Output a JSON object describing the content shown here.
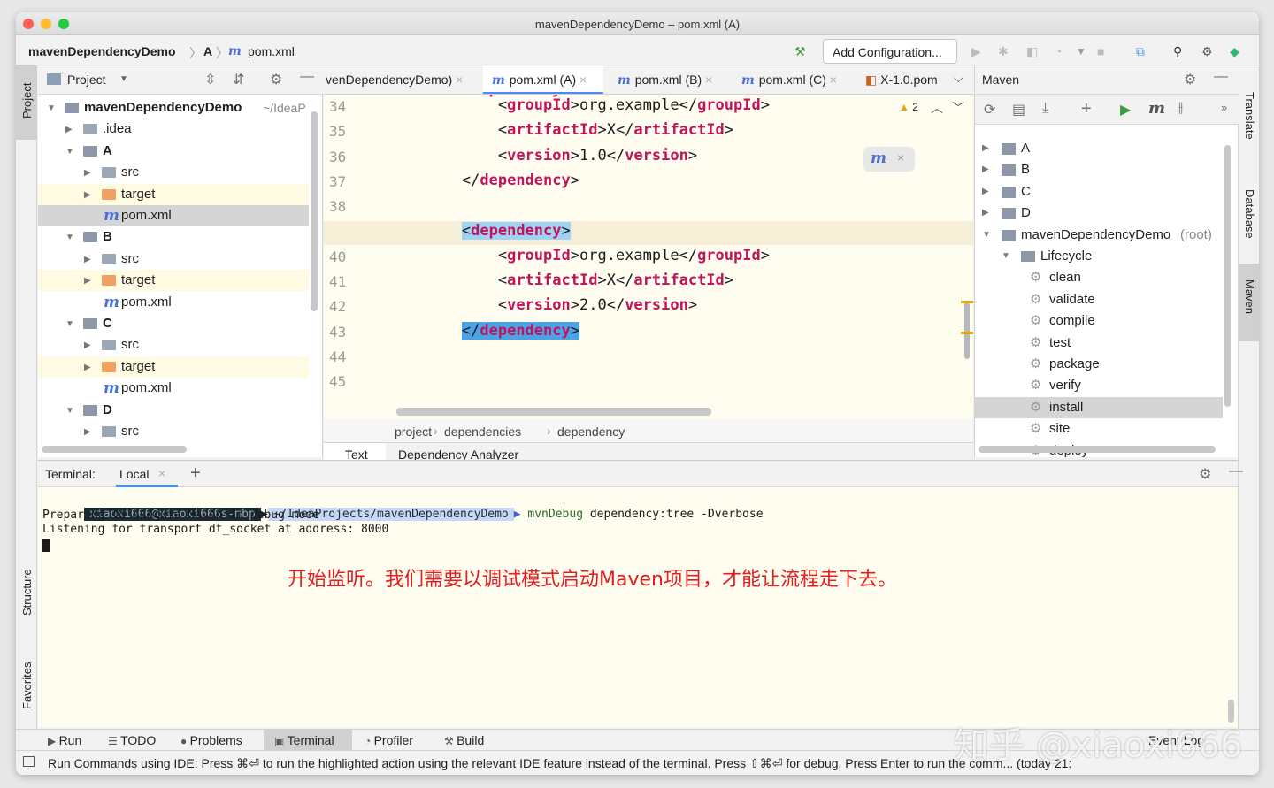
{
  "window": {
    "title": "mavenDependencyDemo – pom.xml (A)"
  },
  "nav": {
    "project": "mavenDependencyDemo",
    "module": "A",
    "file": "pom.xml",
    "add_configuration": "Add Configuration..."
  },
  "project_panel": {
    "title": "Project",
    "tree": [
      {
        "label": "mavenDependencyDemo",
        "suffix": "~/IdeaP",
        "level": 0,
        "expanded": true,
        "type": "module",
        "bold": true
      },
      {
        "label": ".idea",
        "level": 1,
        "expanded": false,
        "type": "folder"
      },
      {
        "label": "A",
        "level": 1,
        "expanded": true,
        "type": "module",
        "bold": true
      },
      {
        "label": "src",
        "level": 2,
        "expanded": false,
        "type": "folder"
      },
      {
        "label": "target",
        "level": 2,
        "expanded": false,
        "type": "target"
      },
      {
        "label": "pom.xml",
        "level": 2,
        "type": "pom",
        "selected": true
      },
      {
        "label": "B",
        "level": 1,
        "expanded": true,
        "type": "module",
        "bold": true
      },
      {
        "label": "src",
        "level": 2,
        "expanded": false,
        "type": "folder"
      },
      {
        "label": "target",
        "level": 2,
        "expanded": false,
        "type": "target"
      },
      {
        "label": "pom.xml",
        "level": 2,
        "type": "pom"
      },
      {
        "label": "C",
        "level": 1,
        "expanded": true,
        "type": "module",
        "bold": true
      },
      {
        "label": "src",
        "level": 2,
        "expanded": false,
        "type": "folder"
      },
      {
        "label": "target",
        "level": 2,
        "expanded": false,
        "type": "target"
      },
      {
        "label": "pom.xml",
        "level": 2,
        "type": "pom"
      },
      {
        "label": "D",
        "level": 1,
        "expanded": true,
        "type": "module",
        "bold": true
      },
      {
        "label": "src",
        "level": 2,
        "expanded": false,
        "type": "folder"
      }
    ]
  },
  "editor": {
    "tabs": [
      {
        "label": "venDependencyDemo)"
      },
      {
        "label": "pom.xml (A)",
        "active": true
      },
      {
        "label": "pom.xml (B)"
      },
      {
        "label": "pom.xml (C)"
      },
      {
        "label": "X-1.0.pom"
      }
    ],
    "warning_count": "2",
    "lines": [
      {
        "n": "34",
        "indent": "            ",
        "open": "groupId",
        "text": "org.example",
        "close": "groupId"
      },
      {
        "n": "35",
        "indent": "            ",
        "open": "artifactId",
        "text": "X",
        "close": "artifactId"
      },
      {
        "n": "36",
        "indent": "            ",
        "open": "version",
        "text": "1.0",
        "close": "version"
      },
      {
        "n": "37",
        "indent": "        ",
        "close_only": "dependency"
      },
      {
        "n": "38"
      },
      {
        "n": "39",
        "indent": "        ",
        "open_only": "dependency",
        "current": true
      },
      {
        "n": "40",
        "indent": "            ",
        "open": "groupId",
        "text": "org.example",
        "close": "groupId"
      },
      {
        "n": "41",
        "indent": "            ",
        "open": "artifactId",
        "text": "X",
        "close": "artifactId"
      },
      {
        "n": "42",
        "indent": "            ",
        "open": "version",
        "text": "2.0",
        "close": "version"
      },
      {
        "n": "43",
        "indent": "        ",
        "close_only": "dependency",
        "boxed": true
      },
      {
        "n": "44"
      },
      {
        "n": "45"
      }
    ],
    "breadcrumb": [
      "project",
      "dependencies",
      "dependency"
    ],
    "bottom_tabs": [
      "Text",
      "Dependency Analyzer"
    ]
  },
  "maven": {
    "title": "Maven",
    "tree": [
      {
        "label": "A",
        "level": 0,
        "type": "module"
      },
      {
        "label": "B",
        "level": 0,
        "type": "module"
      },
      {
        "label": "C",
        "level": 0,
        "type": "module"
      },
      {
        "label": "D",
        "level": 0,
        "type": "module"
      },
      {
        "label": "mavenDependencyDemo",
        "suffix": "(root)",
        "level": 0,
        "type": "module",
        "expanded": true
      },
      {
        "label": "Lifecycle",
        "level": 1,
        "type": "folder",
        "expanded": true
      },
      {
        "label": "clean",
        "level": 2,
        "type": "goal"
      },
      {
        "label": "validate",
        "level": 2,
        "type": "goal"
      },
      {
        "label": "compile",
        "level": 2,
        "type": "goal"
      },
      {
        "label": "test",
        "level": 2,
        "type": "goal"
      },
      {
        "label": "package",
        "level": 2,
        "type": "goal"
      },
      {
        "label": "verify",
        "level": 2,
        "type": "goal"
      },
      {
        "label": "install",
        "level": 2,
        "type": "goal",
        "selected": true
      },
      {
        "label": "site",
        "level": 2,
        "type": "goal"
      },
      {
        "label": "deploy",
        "level": 2,
        "type": "goal"
      }
    ]
  },
  "terminal": {
    "label": "Terminal:",
    "tab": "Local",
    "prompt_user": "xiaoxi666@xiaoxi666s-mbp",
    "prompt_path": "~/IdeaProjects/mavenDependencyDemo",
    "command": "mvnDebug",
    "args": "dependency:tree -Dverbose",
    "output": [
      "Preparing to execute Maven in debug mode",
      "Listening for transport dt_socket at address: 8000"
    ],
    "annotation": "开始监听。我们需要以调试模式启动Maven项目，才能让流程走下去。"
  },
  "left_strip": {
    "top": "Project",
    "mid": "Structure",
    "bottom": "Favorites"
  },
  "right_strip": {
    "a": "Translate",
    "b": "Database",
    "c": "Maven"
  },
  "bottom_tools": [
    "Run",
    "TODO",
    "Problems",
    "Terminal",
    "Profiler",
    "Build"
  ],
  "bottom_right": [
    "Event Log",
    "External"
  ],
  "status": "Run Commands using IDE: Press ⌘⏎ to run the highlighted action using the relevant IDE feature instead of the terminal. Press ⇧⌘⏎ for debug. Press Enter to run the comm... (today 21:",
  "watermark": "知乎 @xiaoxi666",
  "colors": {
    "accent": "#4a8af4",
    "tag": "#c0145a",
    "annotation": "#e02020"
  }
}
